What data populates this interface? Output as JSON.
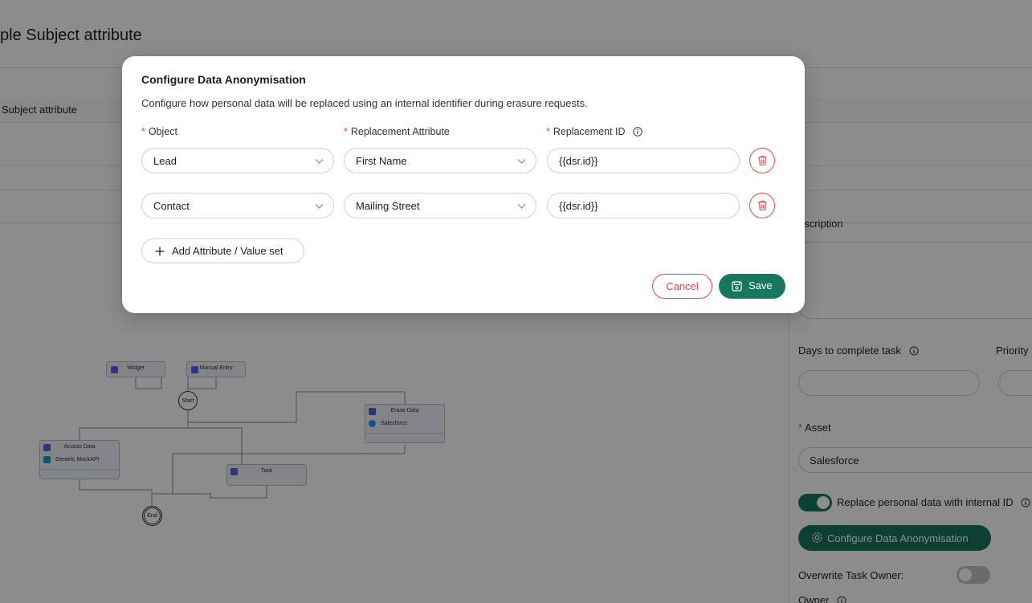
{
  "background": {
    "page_title": "ple Subject attribute",
    "table_header": "Subject attribute",
    "flow": {
      "widget": "Widget",
      "manual_entry": "Manual Entry",
      "start": "Start",
      "erase_data": "Erase Data",
      "erase_system": "Salesforce",
      "access_data": "Access Data",
      "access_system": "Generic MockAPI",
      "task": "Task",
      "end": "End"
    },
    "side_panel": {
      "description_label": "escription",
      "days_label": "Days to complete task",
      "priority_label": "Priority",
      "asset_label": "Asset",
      "asset_value": "Salesforce",
      "replace_toggle_label": "Replace personal data with internal ID",
      "replace_toggle_on": true,
      "configure_button": "Configure Data Anonymisation",
      "overwrite_label": "Overwrite Task Owner:",
      "overwrite_toggle_on": false,
      "owner_label": "Owner"
    }
  },
  "modal": {
    "title": "Configure Data Anonymisation",
    "description": "Configure how personal data will be replaced using an internal identifier during erasure requests.",
    "columns": {
      "object": "Object",
      "replacement_attribute": "Replacement Attribute",
      "replacement_id": "Replacement ID"
    },
    "rows": [
      {
        "object": "Lead",
        "attribute": "First Name",
        "replacement_id": "{{dsr.id}}"
      },
      {
        "object": "Contact",
        "attribute": "Mailing Street",
        "replacement_id": "{{dsr.id}}"
      }
    ],
    "add_button": "Add Attribute / Value set",
    "cancel_button": "Cancel",
    "save_button": "Save"
  },
  "colors": {
    "primary": "#16765e",
    "danger": "#e5484d",
    "overlay": "rgba(0,0,0,0.45)"
  }
}
